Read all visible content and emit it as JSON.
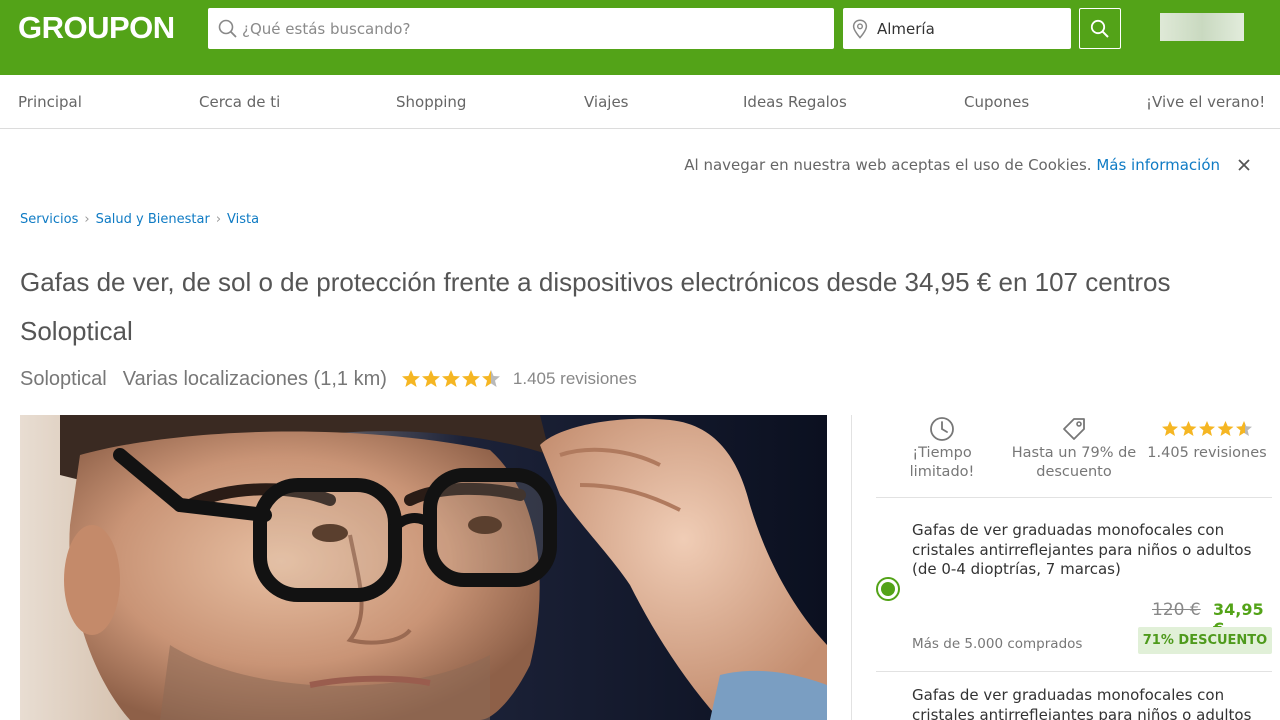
{
  "header": {
    "logo": "GROUPON",
    "search_placeholder": "¿Qué estás buscando?",
    "location_value": "Almería",
    "brand_color": "#53a318"
  },
  "nav": {
    "items": [
      "Principal",
      "Cerca de ti",
      "Shopping",
      "Viajes",
      "Ideas Regalos",
      "Cupones",
      "¡Vive el verano!"
    ]
  },
  "cookie": {
    "text": "Al navegar en nuestra web aceptas el uso de Cookies.",
    "link": "Más información"
  },
  "breadcrumb": [
    "Servicios",
    "Salud y Bienestar",
    "Vista"
  ],
  "deal": {
    "title": "Gafas de ver, de sol o de protección frente a dispositivos electrónicos desde 34,95 € en 107 centros Soloptical",
    "merchant": "Soloptical",
    "location": "Varias localizaciones (1,1 km)",
    "rating": 4.5,
    "reviews": "1.405 revisiones",
    "image": "man-with-glasses-photo"
  },
  "badges": {
    "time": "¡Tiempo limitado!",
    "discount": "Hasta un 79% de descuento",
    "reviews": "1.405 revisiones"
  },
  "options": [
    {
      "title": "Gafas de ver graduadas monofocales con cristales antirreflejantes para niños o adultos (de 0-4 dioptrías, 7 marcas)",
      "old_price": "120 €",
      "new_price": "34,95 €",
      "bought": "Más de 5.000 comprados",
      "discount": "71% DESCUENTO",
      "selected": true
    },
    {
      "title": "Gafas de ver graduadas monofocales con cristales antirreflejantes para niños o adultos"
    }
  ]
}
